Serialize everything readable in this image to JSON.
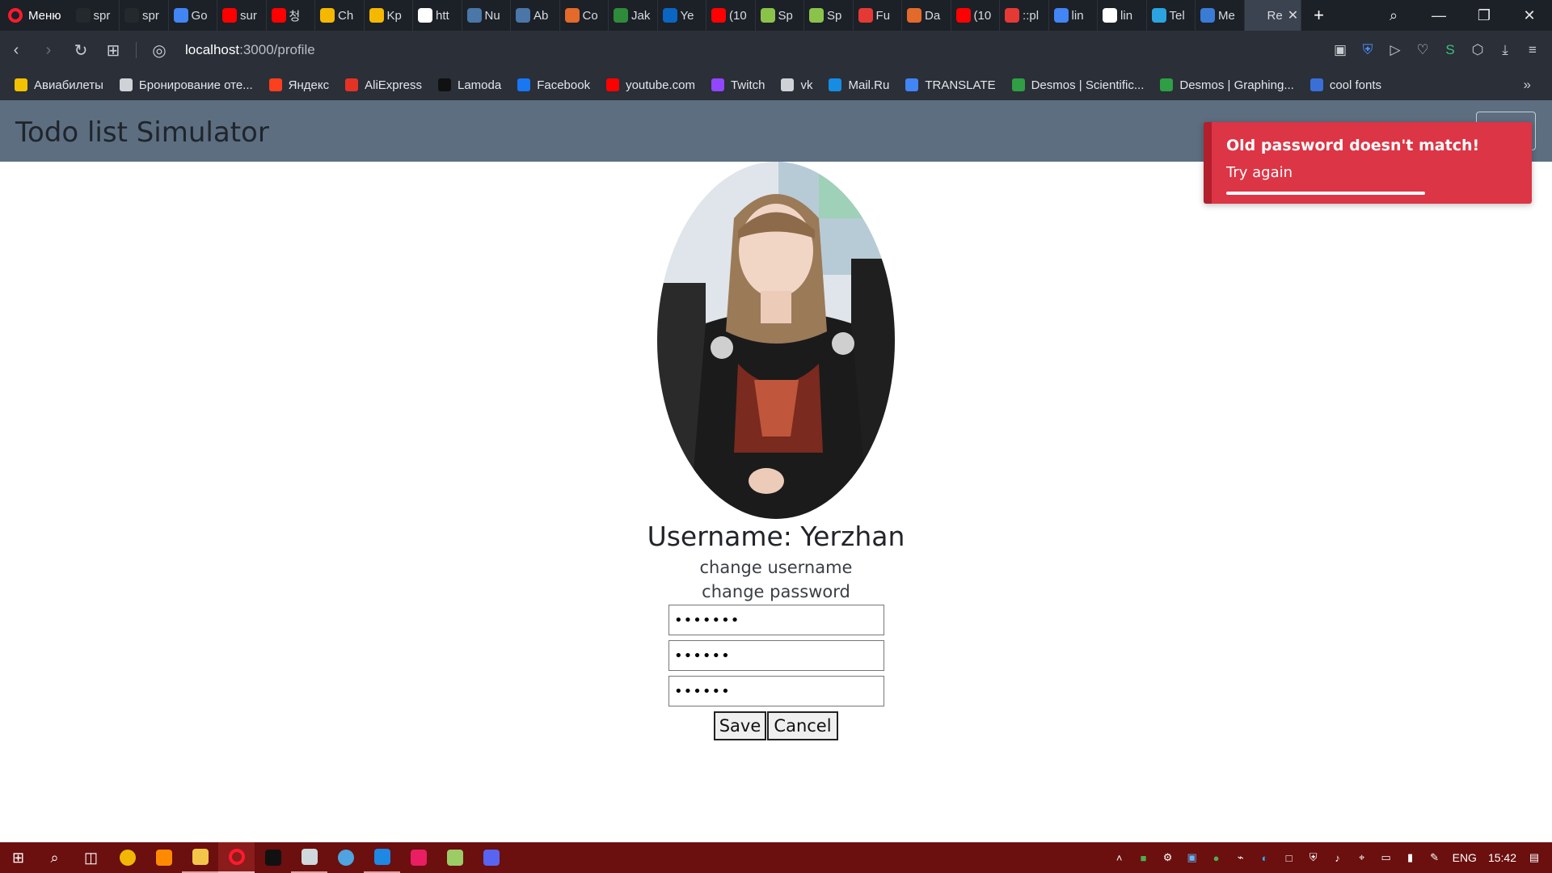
{
  "browser": {
    "menu_label": "Меню",
    "tabs": [
      {
        "label": "spr",
        "icon": "github-icon",
        "color": "#24292e"
      },
      {
        "label": "spr",
        "icon": "github-icon",
        "color": "#24292e"
      },
      {
        "label": "Go",
        "icon": "google-translate-icon",
        "color": "#4285f4"
      },
      {
        "label": "sur",
        "icon": "youtube-icon",
        "color": "#ff0000"
      },
      {
        "label": "청",
        "icon": "youtube-icon",
        "color": "#ff0000"
      },
      {
        "label": "Ch",
        "icon": "kinopoisk-icon",
        "color": "#f5b800"
      },
      {
        "label": "Kp",
        "icon": "kinopoisk-icon",
        "color": "#f5b800"
      },
      {
        "label": "htt",
        "icon": "notion-icon",
        "color": "#ffffff"
      },
      {
        "label": "Nu",
        "icon": "vk-icon",
        "color": "#4a76a8"
      },
      {
        "label": "Ab",
        "icon": "vk-icon",
        "color": "#4a76a8"
      },
      {
        "label": "Co",
        "icon": "coursera-icon",
        "color": "#e36a2b"
      },
      {
        "label": "Jak",
        "icon": "leaf-icon",
        "color": "#2e8b3a"
      },
      {
        "label": "Ye",
        "icon": "linkedin-icon",
        "color": "#0a66c2"
      },
      {
        "label": "(10",
        "icon": "youtube-icon",
        "color": "#ff0000"
      },
      {
        "label": "Sp",
        "icon": "spotify-icon",
        "color": "#8bc34a"
      },
      {
        "label": "Sp",
        "icon": "spotify-icon",
        "color": "#8bc34a"
      },
      {
        "label": "Fu",
        "icon": "target-icon",
        "color": "#e53935"
      },
      {
        "label": "Da",
        "icon": "coursera-icon",
        "color": "#e36a2b"
      },
      {
        "label": "(10",
        "icon": "youtube-icon",
        "color": "#ff0000"
      },
      {
        "label": "::pl",
        "icon": "asterisk-icon",
        "color": "#e53935"
      },
      {
        "label": "lin",
        "icon": "google-icon",
        "color": "#4285f4"
      },
      {
        "label": "lin",
        "icon": "github-icon",
        "color": "#ffffff"
      },
      {
        "label": "Tel",
        "icon": "telegram-icon",
        "color": "#2aa3e0"
      },
      {
        "label": "Me",
        "icon": "messenger-icon",
        "color": "#3a7bd5"
      },
      {
        "label": "Re",
        "icon": "react-icon",
        "color": "#3b4350",
        "active": true
      }
    ],
    "url_host": "localhost",
    "url_path": ":3000/profile",
    "bookmarks": [
      {
        "label": "Авиабилеты",
        "icon": "plane-icon",
        "color": "#f2c200"
      },
      {
        "label": "Бронирование оте...",
        "icon": "page-icon",
        "color": "#cfd3d8"
      },
      {
        "label": "Яндекс",
        "icon": "yandex-icon",
        "color": "#fc3f1d"
      },
      {
        "label": "AliExpress",
        "icon": "aliexpress-icon",
        "color": "#e43225"
      },
      {
        "label": "Lamoda",
        "icon": "lamoda-icon",
        "color": "#111111"
      },
      {
        "label": "Facebook",
        "icon": "facebook-icon",
        "color": "#1877f2"
      },
      {
        "label": "youtube.com",
        "icon": "youtube-icon",
        "color": "#ff0000"
      },
      {
        "label": "Twitch",
        "icon": "twitch-icon",
        "color": "#9146ff"
      },
      {
        "label": "vk",
        "icon": "page-icon",
        "color": "#cfd3d8"
      },
      {
        "label": "Mail.Ru",
        "icon": "mailru-icon",
        "color": "#168de2"
      },
      {
        "label": "TRANSLATE",
        "icon": "google-translate-icon",
        "color": "#4285f4"
      },
      {
        "label": "Desmos | Scientific...",
        "icon": "desmos-icon",
        "color": "#2f9e44"
      },
      {
        "label": "Desmos | Graphing...",
        "icon": "desmos-icon",
        "color": "#2f9e44"
      },
      {
        "label": "cool fonts",
        "icon": "c-icon",
        "color": "#3a6fd8"
      }
    ]
  },
  "app": {
    "title": "Todo list Simulator",
    "header_color": "#5d6e80"
  },
  "toast": {
    "title": "Old password doesn't match!",
    "message": "Try again",
    "color": "#dc3545",
    "progress": 0.76
  },
  "profile": {
    "username_text": "Username: Yerzhan",
    "change_username_link": "change username",
    "change_password_link": "change password",
    "old_password_value": "•••••••",
    "new_password_value": "••••••",
    "confirm_password_value": "••••••",
    "save_label": "Save",
    "cancel_label": "Cancel"
  },
  "taskbar": {
    "language": "ENG",
    "time": "15:42",
    "color": "#6b0f0f"
  }
}
